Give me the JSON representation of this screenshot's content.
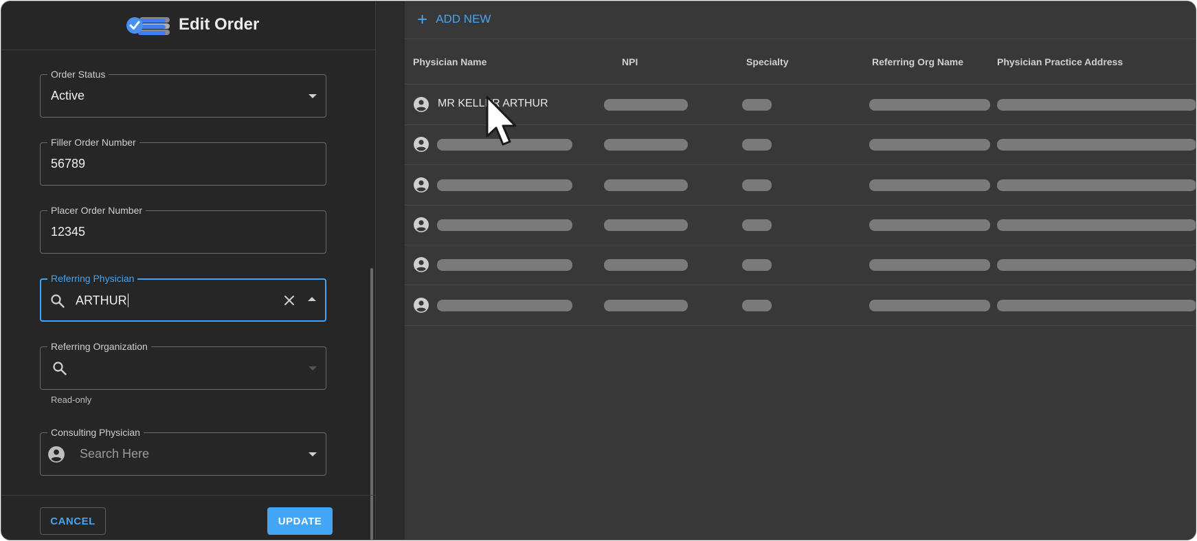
{
  "dialog": {
    "title": "Edit Order",
    "fields": {
      "order_status": {
        "label": "Order Status",
        "value": "Active"
      },
      "filler_order_number": {
        "label": "Filler Order Number",
        "value": "56789"
      },
      "placer_order_number": {
        "label": "Placer Order Number",
        "value": "12345"
      },
      "referring_physician": {
        "label": "Referring Physician",
        "value": "ARTHUR"
      },
      "referring_organization": {
        "label": "Referring Organization",
        "value": "",
        "helper": "Read-only"
      },
      "consulting_physician": {
        "label": "Consulting Physician",
        "placeholder": "Search Here"
      }
    },
    "buttons": {
      "cancel": "CANCEL",
      "update": "UPDATE"
    }
  },
  "panel": {
    "add_new": "ADD NEW",
    "columns": [
      "Physician Name",
      "NPI",
      "Specialty",
      "Referring Org Name",
      "Physician Practice Address"
    ],
    "rows": [
      {
        "physician_name": "MR KELLER ARTHUR",
        "loading": false
      },
      {
        "physician_name": "",
        "loading": true
      },
      {
        "physician_name": "",
        "loading": true
      },
      {
        "physician_name": "",
        "loading": true
      },
      {
        "physician_name": "",
        "loading": true
      },
      {
        "physician_name": "",
        "loading": true
      }
    ]
  },
  "colors": {
    "accent": "#42a5f5",
    "panel_bg": "#383838",
    "dialog_bg": "#262626",
    "skeleton": "#7a7a7a"
  },
  "icons": [
    "logo-icon",
    "search-icon",
    "clear-icon",
    "person-icon",
    "plus-icon",
    "mouse-pointer-icon"
  ]
}
